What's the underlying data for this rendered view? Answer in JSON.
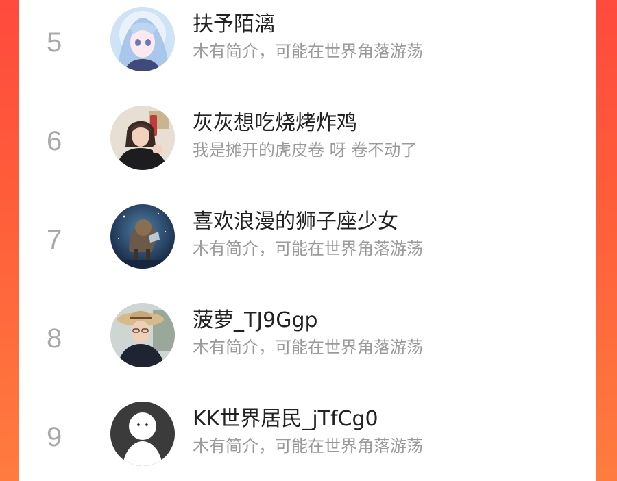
{
  "ranking": {
    "items": [
      {
        "rank": "5",
        "name": "扶予陌漓",
        "bio": "木有简介，可能在世界角落游荡",
        "avatar_icon": "anime-girl-avatar"
      },
      {
        "rank": "6",
        "name": "灰灰想吃烧烤炸鸡",
        "bio": "我是摊开的虎皮卷 呀 卷不动了",
        "avatar_icon": "selfie-photo-avatar"
      },
      {
        "rank": "7",
        "name": "喜欢浪漫的狮子座少女",
        "bio": "木有简介，可能在世界角落游荡",
        "avatar_icon": "lion-constellation-avatar"
      },
      {
        "rank": "8",
        "name": "菠萝_TJ9Ggp",
        "bio": "木有简介，可能在世界角落游荡",
        "avatar_icon": "woman-sunhat-avatar"
      },
      {
        "rank": "9",
        "name": "KK世界居民_jTfCg0",
        "bio": "木有简介，可能在世界角落游荡",
        "avatar_icon": "default-user-avatar"
      }
    ]
  },
  "colors": {
    "background_accent": "#ff5a3a",
    "card": "#ffffff",
    "rank_text": "#a9a9a9",
    "name_text": "#222222",
    "bio_text": "#9a9a9a"
  }
}
